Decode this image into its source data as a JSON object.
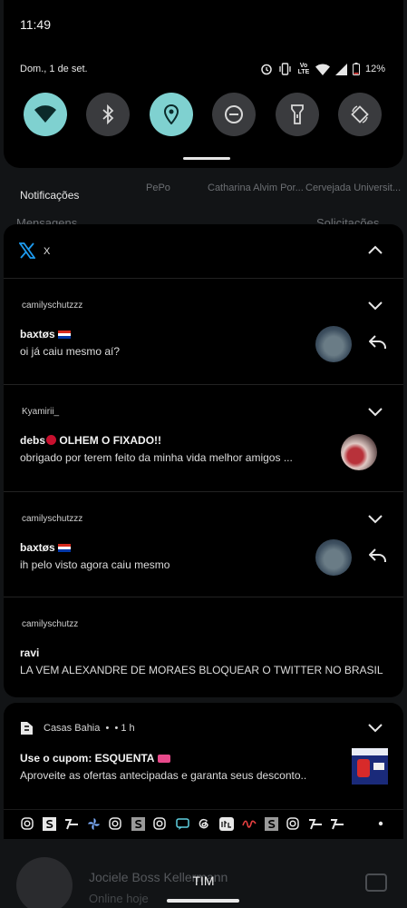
{
  "status": {
    "time": "11:49",
    "date": "Dom., 1 de set.",
    "network_label": "Vo LTE",
    "battery": "12%"
  },
  "quick_tiles": [
    {
      "name": "wifi",
      "on": true
    },
    {
      "name": "bluetooth",
      "on": false
    },
    {
      "name": "location",
      "on": true
    },
    {
      "name": "do-not-disturb",
      "on": false
    },
    {
      "name": "flashlight",
      "on": false
    },
    {
      "name": "auto-rotate",
      "on": false
    }
  ],
  "section_title": "Notificações",
  "background_app": {
    "story_names": [
      "PePo",
      "Catharina Alvim Por...",
      "Cervejada Universit..."
    ],
    "tabs": [
      "Mensagens",
      "Solicitações"
    ],
    "chat_name": "Jociele Boss Kellermann",
    "chat_sub": "Online hoje"
  },
  "x_group": {
    "app_name": "X",
    "messages": [
      {
        "account": "camilyschutzzz",
        "title": "baxtøs",
        "text": "oi já caiu mesmo aí?",
        "has_reply": true
      },
      {
        "account": "Kyamirii_",
        "title": "debs",
        "title_rest": "OLHEM O FIXADO!!",
        "text": "obrigado por terem feito da minha vida melhor amigos ...",
        "has_reply": false
      },
      {
        "account": "camilyschutzzz",
        "title": "baxtøs",
        "text": "ih pelo visto agora caiu mesmo",
        "has_reply": true
      },
      {
        "account": "camilyschutzz",
        "title": "ravi",
        "text": "LA VEM ALEXANDRE DE MORAES BLOQUEAR O TWITTER NO BRASIL",
        "has_reply": false
      }
    ]
  },
  "casas_bahia": {
    "app_name": "Casas Bahia",
    "time_ago": "1 h",
    "title": "Use o cupom: ESQUENTA",
    "text": "Aproveite as ofertas antecipadas e garanta seus desconto.."
  },
  "carrier": "TIM",
  "colors": {
    "accent": "#7fd1d0",
    "x_blue": "#1d9bf0",
    "panel": "#000000"
  }
}
